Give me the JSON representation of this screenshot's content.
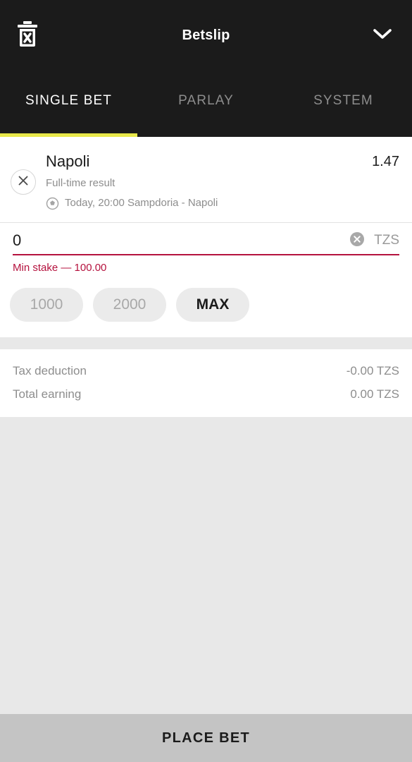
{
  "header": {
    "title": "Betslip",
    "clear_icon": "trash-delete-icon",
    "collapse_icon": "chevron-down-icon"
  },
  "tabs": {
    "items": [
      {
        "label": "SINGLE BET",
        "active": true
      },
      {
        "label": "PARLAY",
        "active": false
      },
      {
        "label": "SYSTEM",
        "active": false
      }
    ],
    "indicator_color": "#e8e84a"
  },
  "bet": {
    "remove_icon": "close-x-icon",
    "selection": "Napoli",
    "market": "Full-time result",
    "sport_icon": "soccer-ball-icon",
    "event": "Today, 20:00 Sampdoria - Napoli",
    "odds": "1.47"
  },
  "stake": {
    "value": "0",
    "placeholder": "0",
    "clear_icon": "clear-circle-x-icon",
    "currency": "TZS",
    "error": "Min stake — 100.00",
    "error_color": "#b5123e",
    "quick_amounts": [
      {
        "label": "1000",
        "emphasis": false
      },
      {
        "label": "2000",
        "emphasis": false
      },
      {
        "label": "MAX",
        "emphasis": true
      }
    ]
  },
  "summary": {
    "rows": [
      {
        "label": "Tax deduction",
        "value": "-0.00 TZS"
      },
      {
        "label": "Total earning",
        "value": "0.00 TZS"
      }
    ]
  },
  "footer": {
    "place_bet_label": "PLACE BET"
  }
}
